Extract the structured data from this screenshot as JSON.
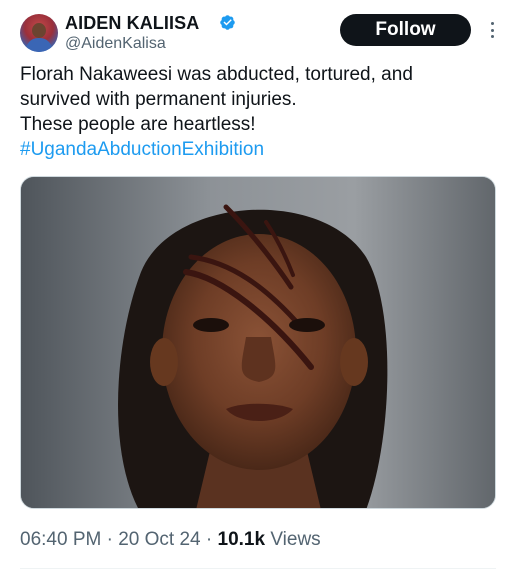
{
  "author": {
    "display_name": "AIDEN KALIISA",
    "handle": "@AidenKalisa",
    "verified": true,
    "avatar_icon": "avatar-image"
  },
  "actions": {
    "follow_label": "Follow",
    "more_icon": "more-vertical-icon"
  },
  "tweet": {
    "lines": [
      "Florah Nakaweesi was abducted, tortured, and",
      "survived with permanent injuries.",
      "These people are heartless!"
    ],
    "hashtag": "#UgandaAbductionExhibition"
  },
  "meta": {
    "time": "06:40 PM",
    "sep1": " · ",
    "date": "20 Oct 24",
    "sep2": " · ",
    "views_count": "10.1k",
    "views_label": " Views"
  },
  "colors": {
    "text": "#0f1419",
    "secondary": "#536471",
    "link": "#1d9bf0",
    "verified": "#1d9bf0",
    "button": "#0f1419"
  }
}
